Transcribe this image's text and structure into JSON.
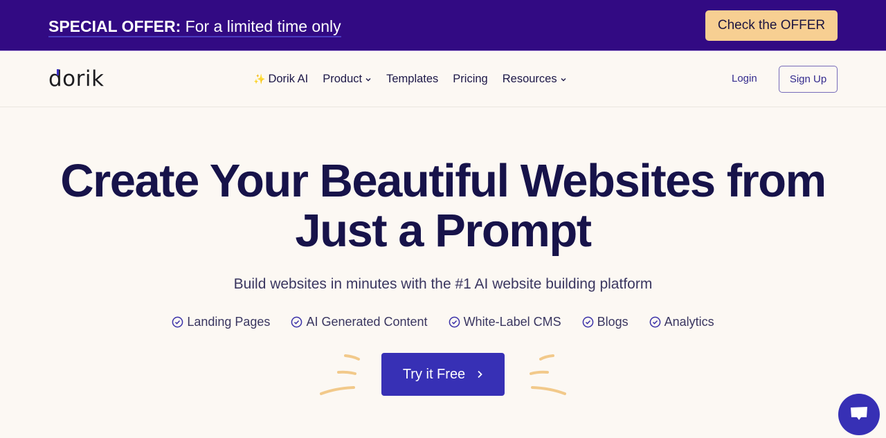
{
  "promo": {
    "bold": "SPECIAL OFFER:",
    "text": " For a limited time only",
    "button_label": "Check the OFFER"
  },
  "nav": {
    "logo": "dorik",
    "links": [
      {
        "label": "Dorik AI",
        "icon": "sparkle-icon",
        "dropdown": false
      },
      {
        "label": "Product",
        "dropdown": true
      },
      {
        "label": "Templates",
        "dropdown": false
      },
      {
        "label": "Pricing",
        "dropdown": false
      },
      {
        "label": "Resources",
        "dropdown": true
      }
    ],
    "login_label": "Login",
    "signup_label": "Sign Up"
  },
  "hero": {
    "title_line1": "Create Your Beautiful Websites from",
    "title_line2": "Just a Prompt",
    "subtitle": "Build websites in minutes with the #1 AI website building platform",
    "features": [
      "Landing Pages",
      "AI Generated Content",
      "White-Label CMS",
      "Blogs",
      "Analytics"
    ],
    "cta_label": "Try it Free",
    "cta_icon": "chevron-right-icon"
  },
  "chat": {
    "icon": "chat-bubble-icon"
  },
  "colors": {
    "promo_bg": "#320a83",
    "offer_button": "#f7cf92",
    "primary": "#3730b5",
    "heading": "#17134a",
    "page_bg": "#fcf8f3"
  }
}
